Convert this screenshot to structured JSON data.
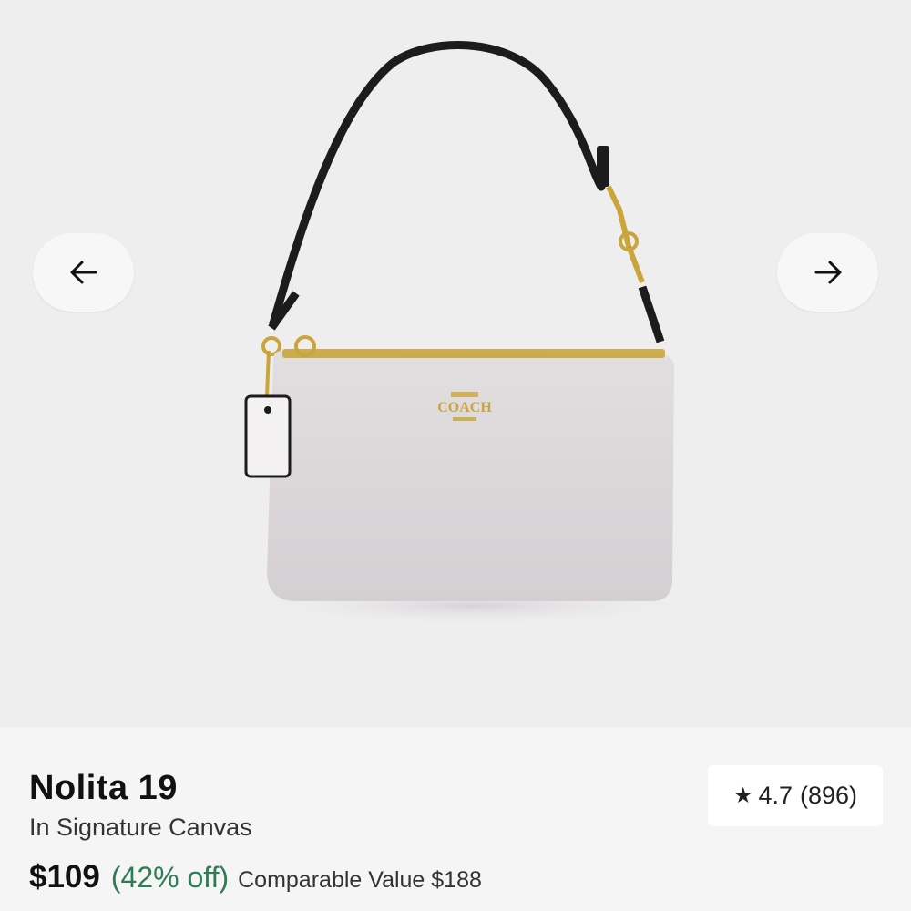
{
  "gallery": {
    "prev_icon": "arrow-left-icon",
    "next_icon": "arrow-right-icon",
    "image_alt": "product-image"
  },
  "product": {
    "name": "Nolita 19",
    "subtitle": "In Signature Canvas",
    "price": "$109",
    "discount": "(42% off)",
    "comparable": "Comparable Value $188"
  },
  "rating": {
    "icon": "star-icon",
    "value": "4.7",
    "count": "(896)"
  },
  "colors": {
    "discount": "#2e7d57",
    "accent": "#111111"
  }
}
